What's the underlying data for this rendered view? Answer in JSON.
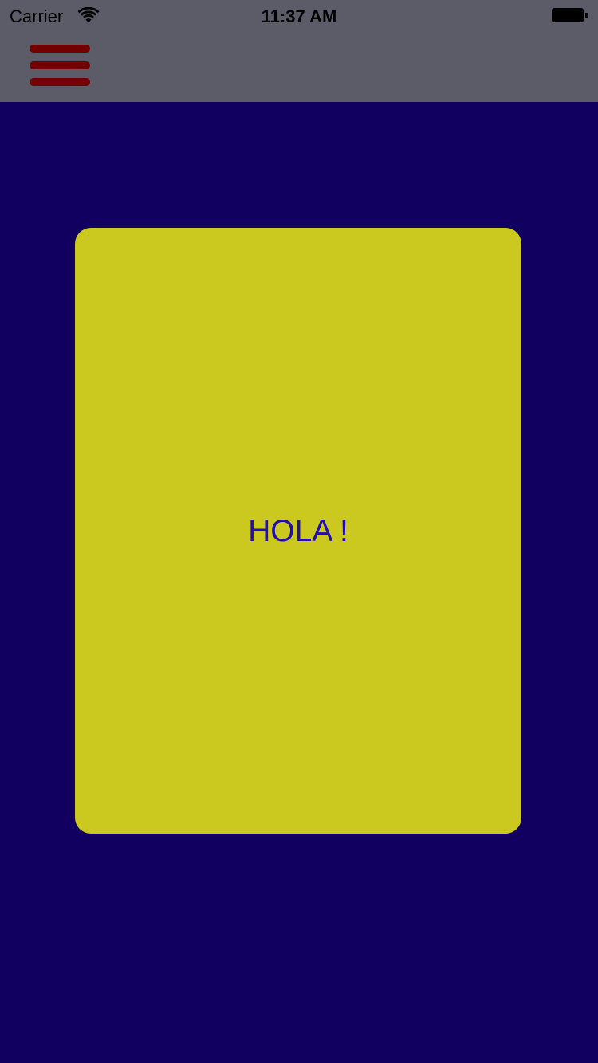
{
  "status_bar": {
    "carrier": "Carrier",
    "time": "11:37 AM"
  },
  "toolbar": {
    "menu_icon": "hamburger-menu-icon"
  },
  "card": {
    "text": "HOLA !"
  },
  "colors": {
    "background": "#120060",
    "topbar": "#5c5b68",
    "menu_icon": "#720000",
    "card": "#cbc81f",
    "card_text": "#2410a8"
  }
}
